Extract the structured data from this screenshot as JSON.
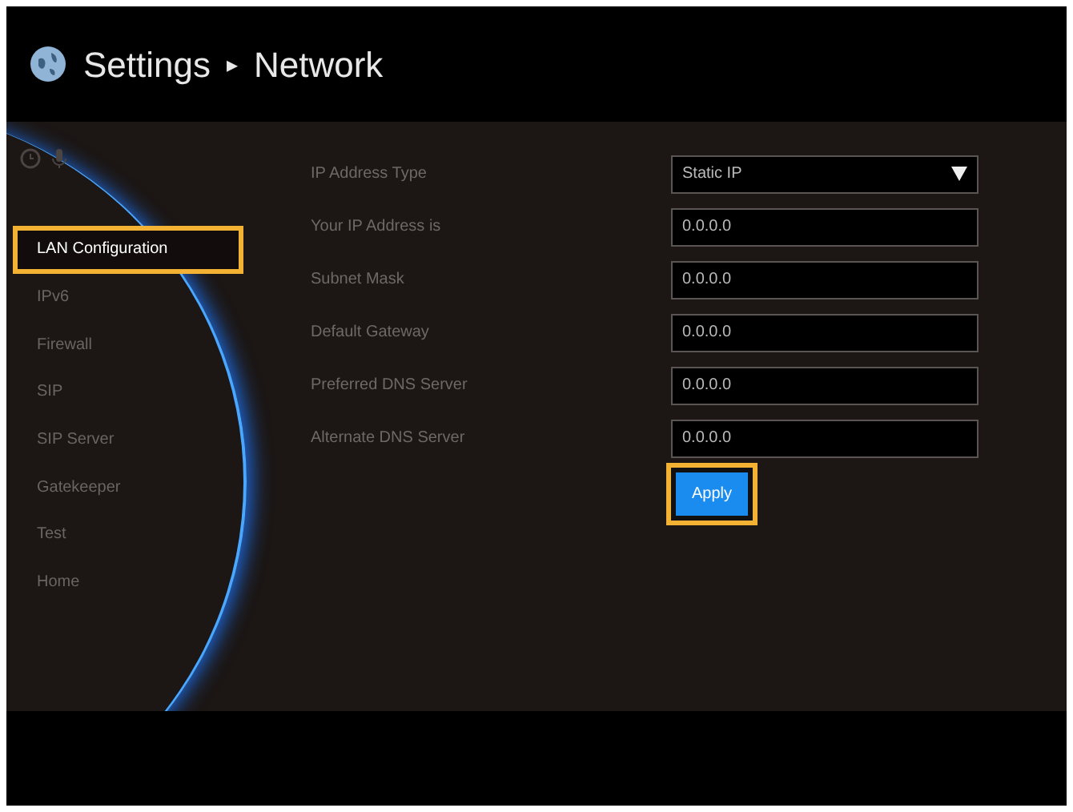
{
  "header": {
    "breadcrumb": [
      {
        "label": "Settings"
      },
      {
        "label": "Network"
      }
    ],
    "separator": "▸"
  },
  "sidebar": {
    "items": [
      {
        "label": "LAN Configuration",
        "selected": true
      },
      {
        "label": "IPv6",
        "selected": false
      },
      {
        "label": "Firewall",
        "selected": false
      },
      {
        "label": "SIP",
        "selected": false
      },
      {
        "label": "SIP Server",
        "selected": false
      },
      {
        "label": "Gatekeeper",
        "selected": false
      },
      {
        "label": "Test",
        "selected": false
      },
      {
        "label": "Home",
        "selected": false
      }
    ]
  },
  "form": {
    "fields": [
      {
        "label": "IP Address Type",
        "kind": "dropdown",
        "value": "Static IP"
      },
      {
        "label": "Your IP Address is",
        "kind": "text",
        "value": "0.0.0.0"
      },
      {
        "label": "Subnet Mask",
        "kind": "text",
        "value": "0.0.0.0"
      },
      {
        "label": "Default Gateway",
        "kind": "text",
        "value": "0.0.0.0"
      },
      {
        "label": "Preferred DNS Server",
        "kind": "text",
        "value": "0.0.0.0"
      },
      {
        "label": "Alternate DNS Server",
        "kind": "text",
        "value": "0.0.0.0"
      }
    ],
    "apply_button": {
      "label": "Apply",
      "focused": true
    }
  }
}
